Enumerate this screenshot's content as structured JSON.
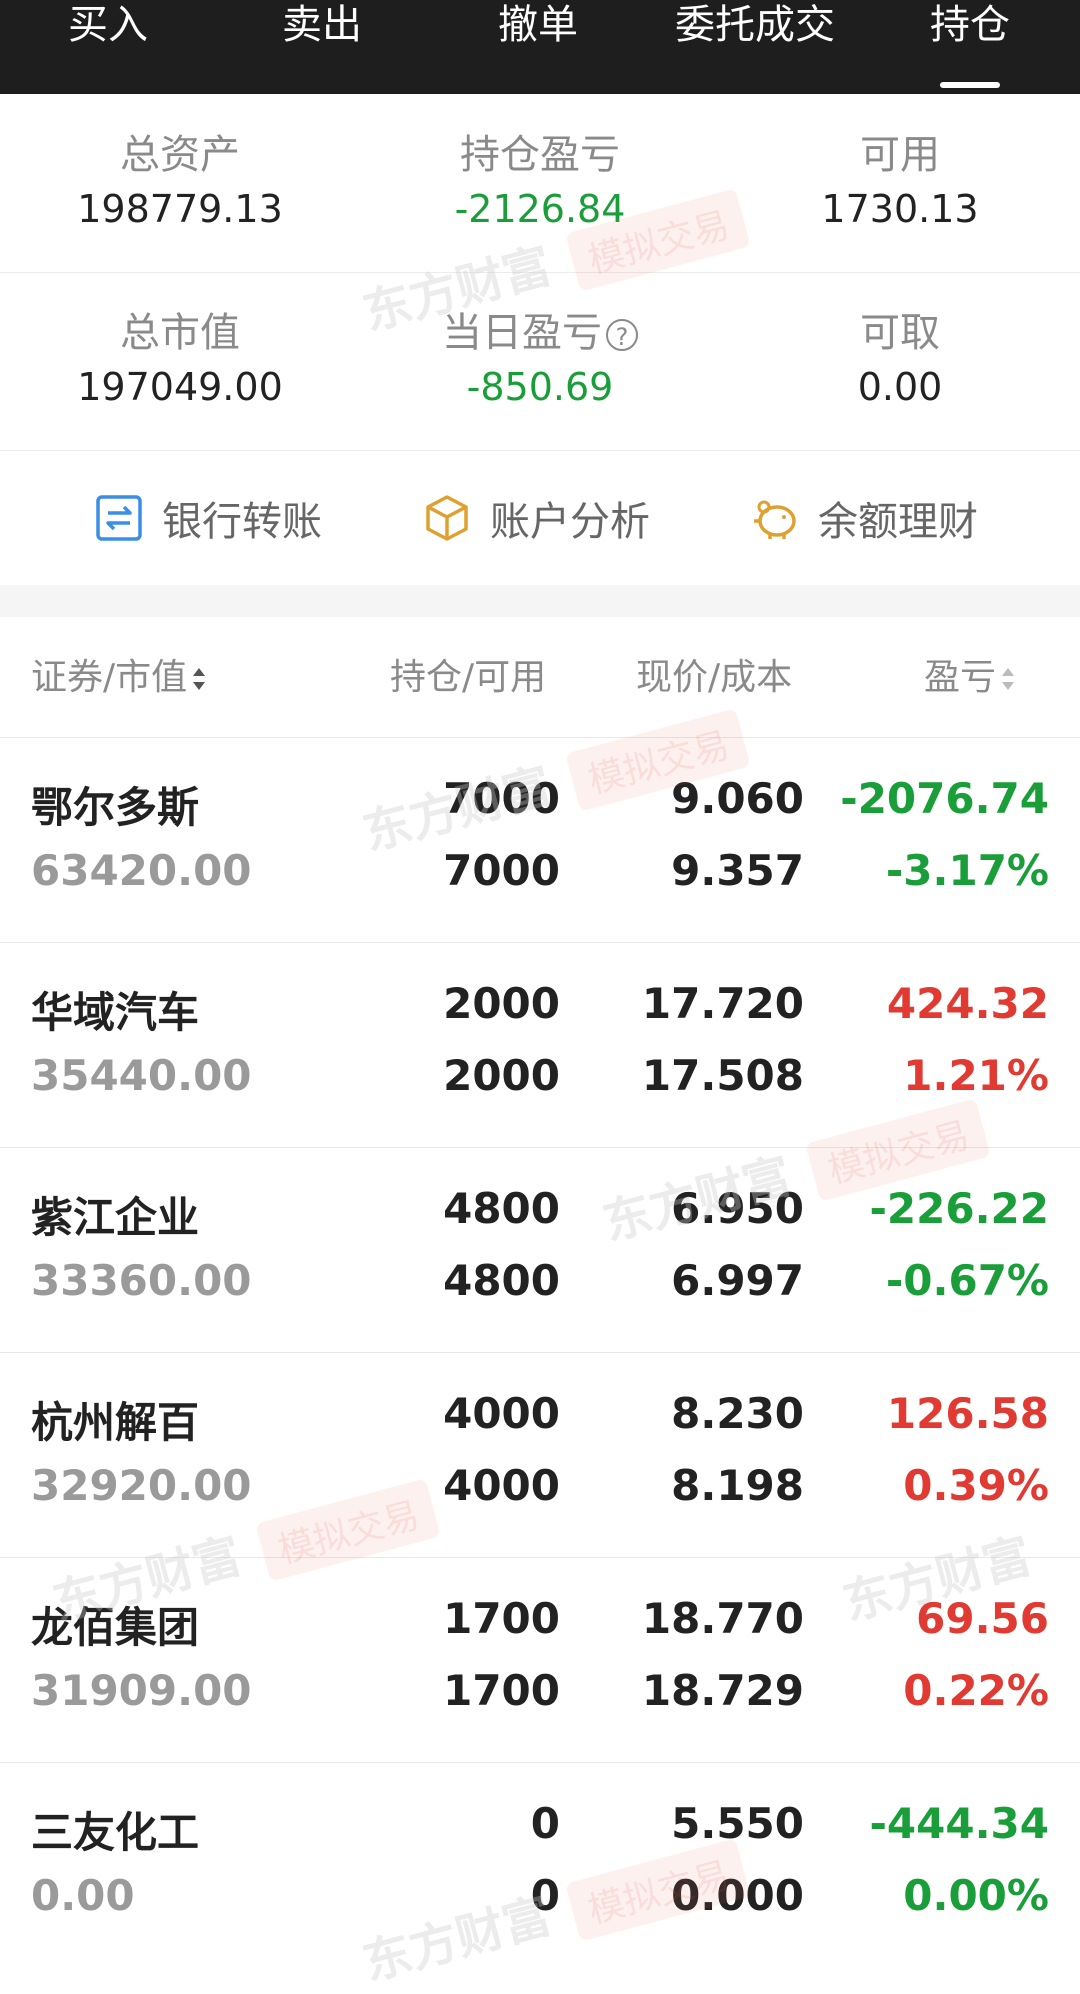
{
  "tabs": [
    {
      "label": "买入"
    },
    {
      "label": "卖出"
    },
    {
      "label": "撤单"
    },
    {
      "label": "委托成交"
    },
    {
      "label": "持仓"
    }
  ],
  "summary": {
    "total_assets_label": "总资产",
    "total_assets": "198779.13",
    "position_pl_label": "持仓盈亏",
    "position_pl": "-2126.84",
    "available_label": "可用",
    "available": "1730.13",
    "market_value_label": "总市值",
    "market_value": "197049.00",
    "daily_pl_label": "当日盈亏",
    "daily_pl": "-850.69",
    "withdrawable_label": "可取",
    "withdrawable": "0.00"
  },
  "actions": {
    "bank_transfer": "银行转账",
    "account_analysis": "账户分析",
    "balance_finance": "余额理财"
  },
  "table_header": {
    "security": "证券/市值",
    "position": "持仓/可用",
    "price": "现价/成本",
    "pl": "盈亏"
  },
  "holdings": [
    {
      "name": "鄂尔多斯",
      "market_value": "63420.00",
      "position": "7000",
      "available": "7000",
      "price": "9.060",
      "cost": "9.357",
      "pl": "-2076.74",
      "pl_pct": "-3.17%",
      "trend": "down"
    },
    {
      "name": "华域汽车",
      "market_value": "35440.00",
      "position": "2000",
      "available": "2000",
      "price": "17.720",
      "cost": "17.508",
      "pl": "424.32",
      "pl_pct": "1.21%",
      "trend": "up"
    },
    {
      "name": "紫江企业",
      "market_value": "33360.00",
      "position": "4800",
      "available": "4800",
      "price": "6.950",
      "cost": "6.997",
      "pl": "-226.22",
      "pl_pct": "-0.67%",
      "trend": "down"
    },
    {
      "name": "杭州解百",
      "market_value": "32920.00",
      "position": "4000",
      "available": "4000",
      "price": "8.230",
      "cost": "8.198",
      "pl": "126.58",
      "pl_pct": "0.39%",
      "trend": "up"
    },
    {
      "name": "龙佰集团",
      "market_value": "31909.00",
      "position": "1700",
      "available": "1700",
      "price": "18.770",
      "cost": "18.729",
      "pl": "69.56",
      "pl_pct": "0.22%",
      "trend": "up"
    },
    {
      "name": "三友化工",
      "market_value": "0.00",
      "position": "0",
      "available": "0",
      "price": "5.550",
      "cost": "0.000",
      "pl": "-444.34",
      "pl_pct": "0.00%",
      "trend": "down"
    }
  ],
  "watermark": {
    "brand": "东方财富",
    "badge": "模拟交易"
  },
  "colors": {
    "up": "#e03a32",
    "down": "#1a9e3a",
    "header_bg": "#1e1e1e",
    "accent_blue": "#3a8ee6",
    "accent_gold": "#e0a030"
  }
}
